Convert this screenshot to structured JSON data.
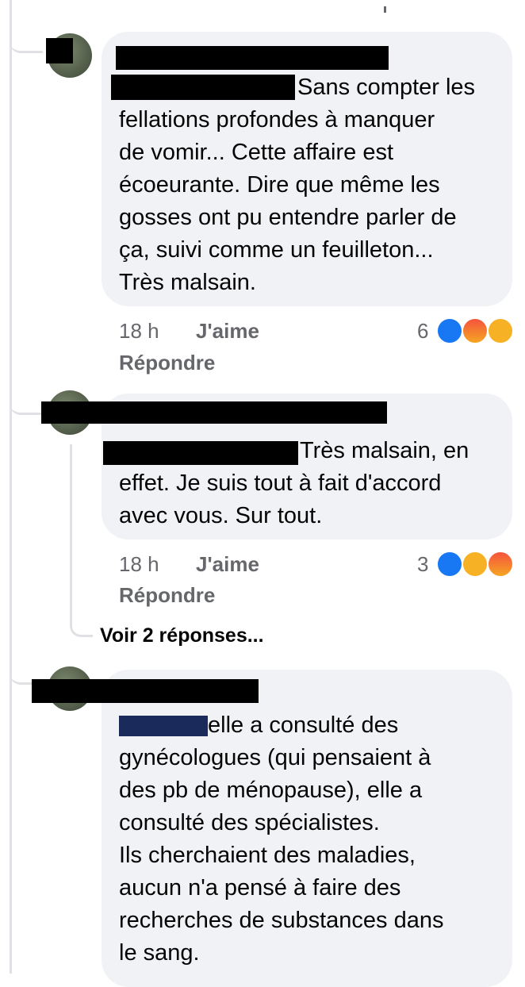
{
  "comments": [
    {
      "text_lines": [
        "Sans compter les",
        "fellations profondes à manquer",
        "de vomir... Cette affaire est",
        "écoeurante. Dire que même les",
        "gosses ont pu entendre parler de",
        "ça, suivi comme un feuilleton...",
        "Très malsain."
      ],
      "time": "18 h",
      "like_label": "J'aime",
      "reply_label": "Répondre",
      "reaction_count": "6",
      "reactions": [
        "like-icon",
        "angry-icon",
        "care-icon"
      ]
    },
    {
      "text_lines": [
        "Très malsain, en",
        "effet. Je suis tout à fait d'accord",
        "avec vous. Sur tout."
      ],
      "time": "18 h",
      "like_label": "J'aime",
      "reply_label": "Répondre",
      "reaction_count": "3",
      "reactions": [
        "like-icon",
        "care-icon",
        "angry-icon"
      ]
    },
    {
      "text_lines": [
        "elle a consulté des",
        "gynécologues (qui pensaient à",
        "des pb de ménopause), elle a",
        "consulté des spécialistes.",
        "Ils cherchaient des maladies,",
        "aucun n'a pensé à faire des",
        "recherches de substances dans",
        "le sang."
      ]
    }
  ],
  "view_more_replies": "Voir 2 réponses...",
  "colors": {
    "bubble": "#f0f2f5",
    "meta": "#65676b",
    "like": "#1877f2",
    "thread_line": "#dfe1e5"
  }
}
